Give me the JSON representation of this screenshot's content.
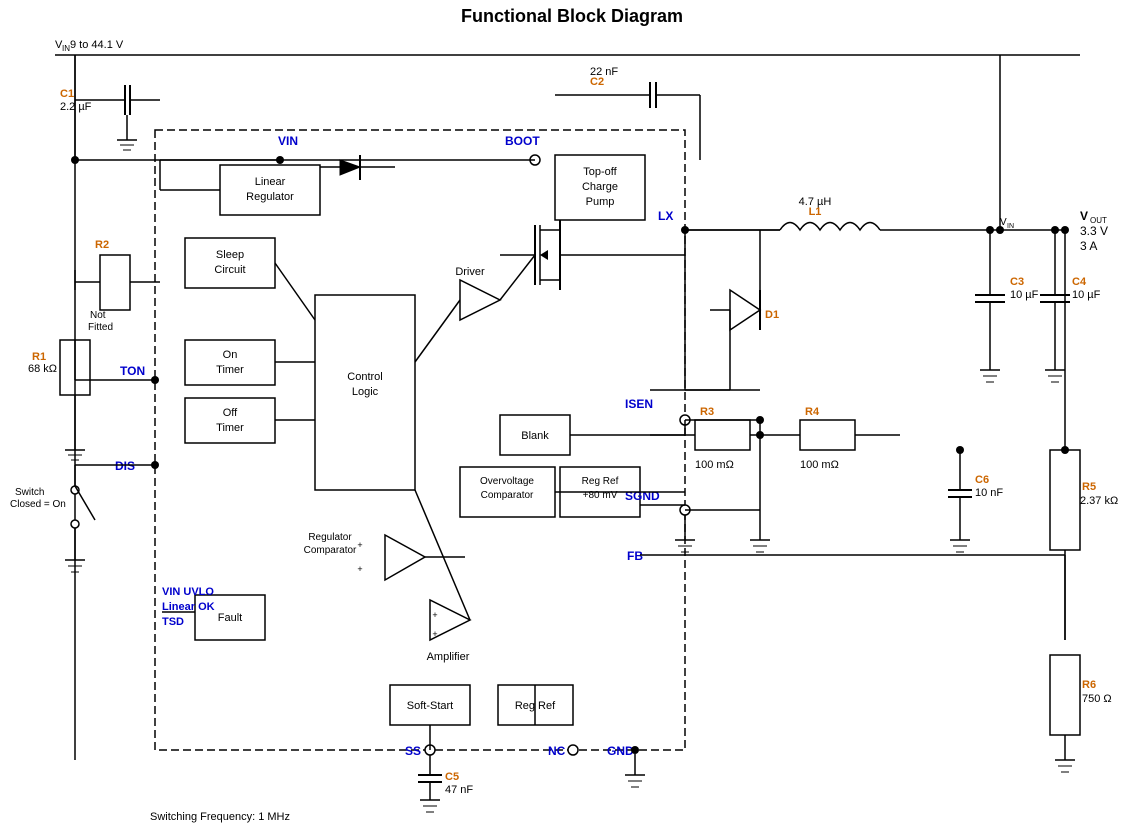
{
  "title": "Functional Block Diagram",
  "components": {
    "C1": {
      "label": "C1",
      "value": "2.2 µF"
    },
    "C2": {
      "label": "C2",
      "value": "22 nF"
    },
    "C3": {
      "label": "C3",
      "value": "10 µF"
    },
    "C4": {
      "label": "C4",
      "value": "10 µF"
    },
    "C5": {
      "label": "C5",
      "value": "47 nF"
    },
    "C6": {
      "label": "C6",
      "value": "10 nF"
    },
    "R1": {
      "label": "R1",
      "value": "68 kΩ"
    },
    "R2": {
      "label": "R2",
      "value": "Not Fitted"
    },
    "R3": {
      "label": "R3",
      "value": "100 mΩ"
    },
    "R4": {
      "label": "R4",
      "value": "100 mΩ"
    },
    "R5": {
      "label": "R5",
      "value": "2.37 kΩ"
    },
    "R6": {
      "label": "R6",
      "value": "750 Ω"
    },
    "L1": {
      "label": "L1",
      "value": "4.7 µH"
    },
    "D1": {
      "label": "D1"
    },
    "VIN_label": "V_IN 9 to 44.1 V",
    "VOUT_label": "V_OUT",
    "VOUT_val": "3.3 V",
    "VOUT_cur": "3 A",
    "pins": {
      "VIN": "VIN",
      "BOOT": "BOOT",
      "LX": "LX",
      "TON": "TON",
      "DIS": "DIS",
      "ISEN": "ISEN",
      "SGND": "SGND",
      "FB": "FB",
      "SS": "SS",
      "NC": "NC",
      "GND": "GND",
      "VIN_UVLO": "VIN UVLO",
      "Linear_OK": "Linear OK",
      "TSD": "TSD"
    },
    "blocks": {
      "linear_reg": "Linear\nRegulator",
      "sleep": "Sleep\nCircuit",
      "on_timer": "On\nTimer",
      "off_timer": "Off\nTimer",
      "control_logic": "Control\nLogic",
      "driver": "Driver",
      "top_off": "Top-off\nCharge\nPump",
      "blank": "Blank",
      "overvoltage": "Overvoltage\nComparator",
      "reg_ref_80": "Reg Ref\n+80 mV",
      "reg_comparator": "Regulator\nComparator",
      "amplifier": "Amplifier",
      "soft_start": "Soft-Start",
      "reg_ref": "Reg Ref",
      "fault": "Fault"
    },
    "switch_label": "Switch\nClosed = On",
    "switching_freq": "Switching Frequency: 1 MHz",
    "VIN_top": "V_IN"
  }
}
